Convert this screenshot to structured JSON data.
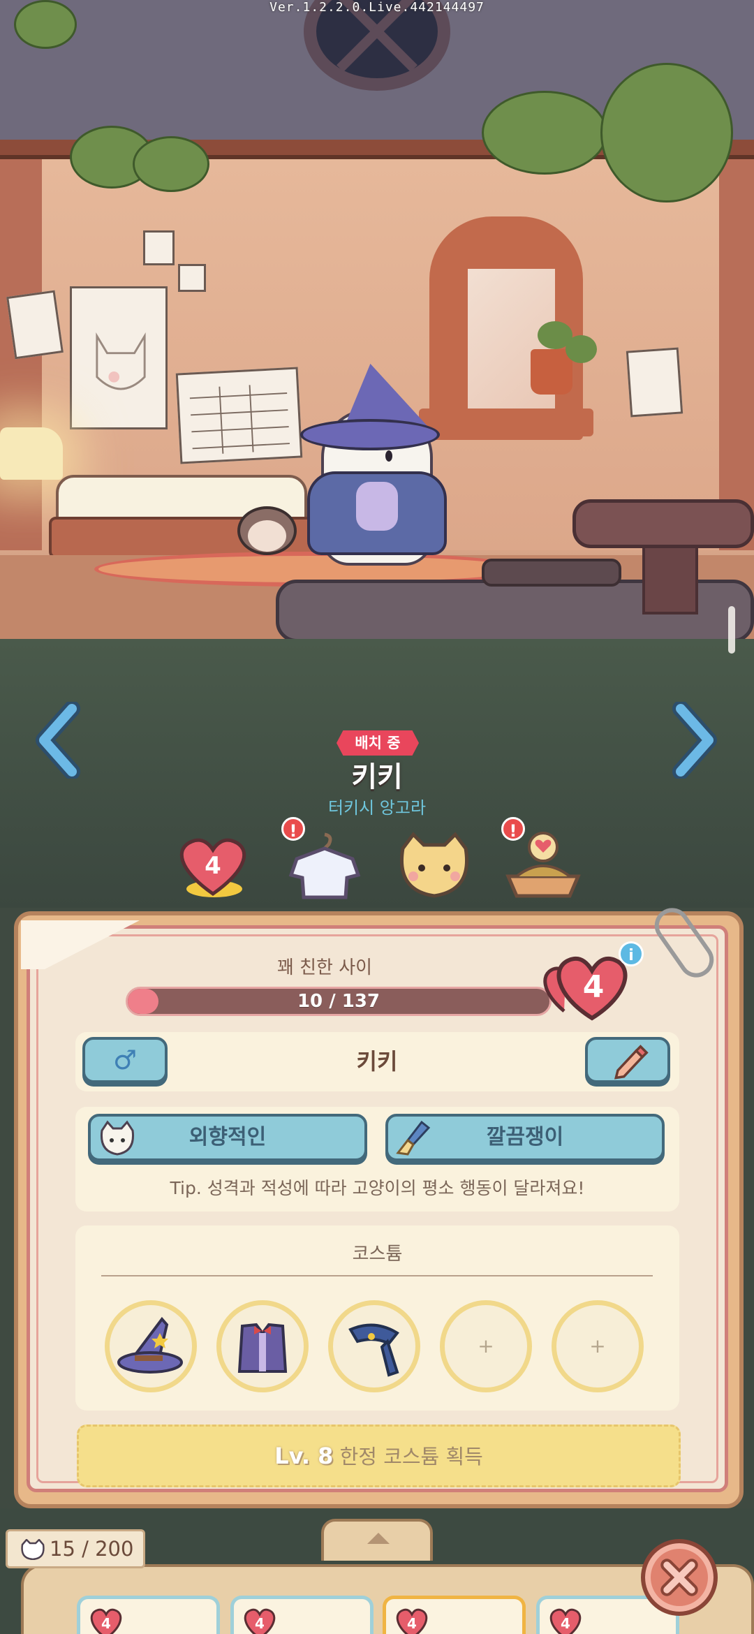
{
  "system": {
    "version": "Ver.1.2.2.0.Live.442144497"
  },
  "cat": {
    "status_badge": "배치 중",
    "name": "키키",
    "breed": "터키시 앙고라"
  },
  "tabs": [
    {
      "id": "affection",
      "icon": "heart-level-icon",
      "value": "4",
      "alert": false,
      "selected": true
    },
    {
      "id": "costume",
      "icon": "shirt-hanger-icon",
      "alert": true,
      "alert_text": "!"
    },
    {
      "id": "profile",
      "icon": "cat-face-icon",
      "alert": false
    },
    {
      "id": "food",
      "icon": "food-bowl-icon",
      "alert": true,
      "alert_text": "!"
    }
  ],
  "panel": {
    "relationship_title": "꽤 친한 사이",
    "affection": {
      "current": 10,
      "max": 137,
      "text": "10 / 137",
      "fraction": 0.073
    },
    "level": "4",
    "info_label": "i",
    "gender_symbol": "♂",
    "name_value": "키키",
    "traits": [
      {
        "label": "외향적인",
        "icon": "cat-face-icon"
      },
      {
        "label": "깔끔쟁이",
        "icon": "brush-icon"
      }
    ],
    "tip": "Tip. 성격과 적성에 따라 고양이의 평소 행동이 달라져요!",
    "costume_title": "코스튬",
    "costume_slots": [
      {
        "icon": "witch-hat-icon",
        "empty": false
      },
      {
        "icon": "vest-icon",
        "empty": false
      },
      {
        "icon": "cape-icon",
        "empty": false
      },
      {
        "icon": "plus-icon",
        "empty": true,
        "label": "+"
      },
      {
        "icon": "plus-icon",
        "empty": true,
        "label": "+"
      }
    ],
    "limited_costume": {
      "level_label": "Lv. 8",
      "text": "한정 코스튬 획득"
    }
  },
  "bottom": {
    "cat_count": "15 / 200",
    "cat_cards": [
      {
        "level": "4",
        "selected": false
      },
      {
        "level": "4",
        "selected": false
      },
      {
        "level": "4",
        "selected": true
      },
      {
        "level": "4",
        "selected": false
      }
    ]
  },
  "colors": {
    "accent_red": "#e9465c",
    "affection_fill": "#ef7f8a",
    "button_blue": "#8fcbd9",
    "breed_text": "#6fc6dd",
    "limited_yellow": "#f5df8b"
  }
}
